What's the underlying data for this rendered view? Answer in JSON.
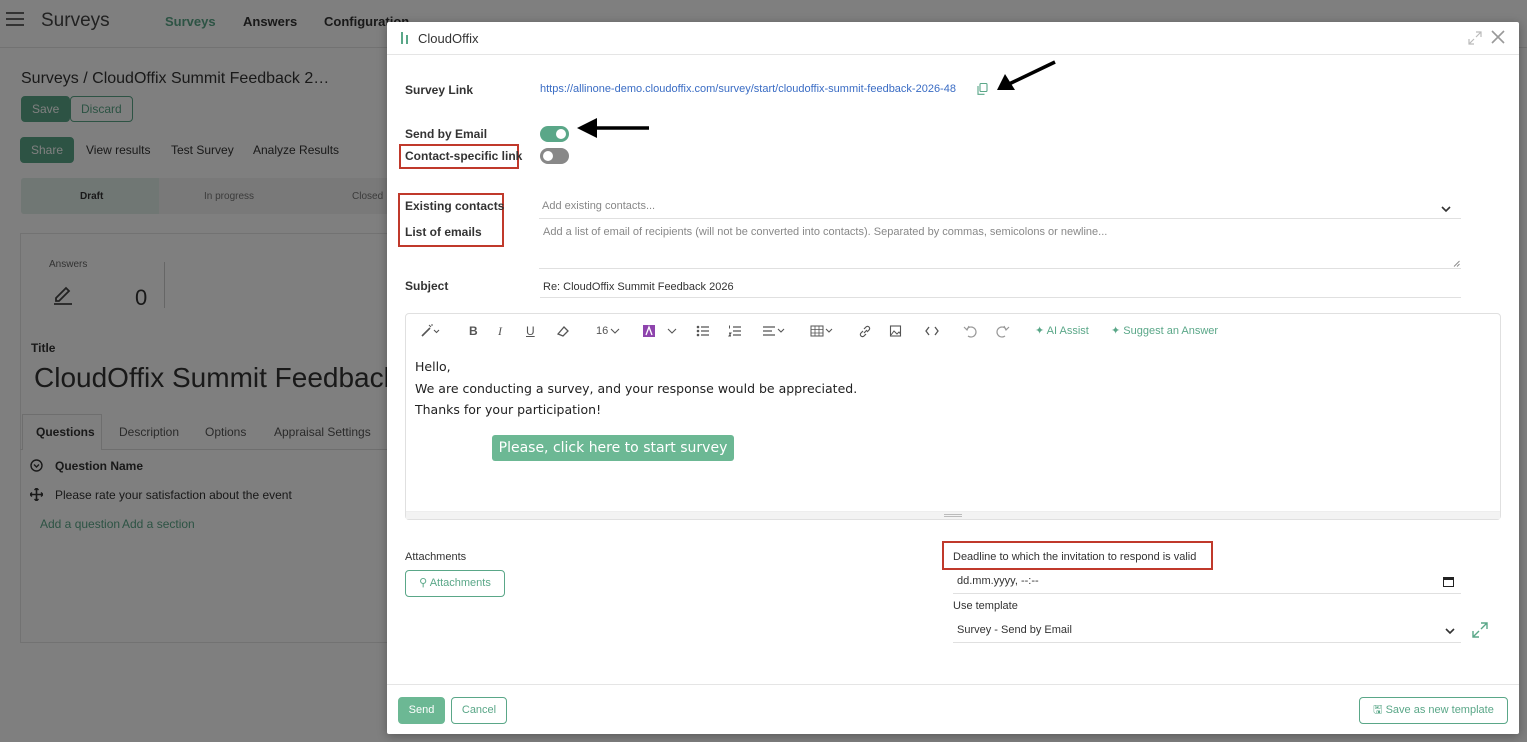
{
  "app": {
    "title": "Surveys",
    "nav": [
      "Surveys",
      "Answers",
      "Configuration"
    ],
    "breadcrumb": "Surveys /  CloudOffix Summit Feedback 2…",
    "save_label": "Save",
    "discard_label": "Discard",
    "share_label": "Share",
    "links": [
      "View results",
      "Test Survey",
      "Analyze Results"
    ],
    "status_steps": [
      "Draft",
      "In progress",
      "Closed"
    ],
    "answers_label": "Answers",
    "answers_count": "0",
    "title_label": "Title",
    "title_value": "CloudOffix Summit Feedback",
    "tabs": [
      "Questions",
      "Description",
      "Options",
      "Appraisal Settings"
    ],
    "question_header": "Question Name",
    "question_row": "Please rate your satisfaction about the event",
    "add_question": "Add a question",
    "add_section": "Add a section"
  },
  "modal": {
    "title": "CloudOffix",
    "survey_link_label": "Survey Link",
    "survey_link": "https://allinone-demo.cloudoffix.com/survey/start/cloudoffix-summit-feedback-2026-48",
    "send_by_email_label": "Send by Email",
    "send_by_email": true,
    "contact_specific_label": "Contact-specific link",
    "contact_specific": false,
    "existing_contacts_label": "Existing contacts",
    "existing_contacts_placeholder": "Add existing contacts...",
    "list_emails_label": "List of emails",
    "list_emails_placeholder": "Add a list of email of recipients (will not be converted into contacts). Separated by commas, semicolons or newline...",
    "subject_label": "Subject",
    "subject_value": "Re: CloudOffix Summit Feedback 2026",
    "toolbar": {
      "font_size": "16",
      "ai_assist": "AI Assist",
      "suggest_answer": "Suggest an Answer"
    },
    "body": {
      "line1": "Hello,",
      "line2": "We are conducting a survey, and your response would be appreciated.",
      "line3": "Thanks for your participation!",
      "cta": "Please, click here to start survey"
    },
    "attachments_label": "Attachments",
    "attachments_button": "Attachments",
    "deadline_label": "Deadline to which the invitation to respond is valid",
    "deadline_placeholder": "dd.mm.yyyy, --:--",
    "template_label": "Use template",
    "template_value": "Survey - Send by Email",
    "send_label": "Send",
    "cancel_label": "Cancel",
    "save_template_label": "Save as new template"
  },
  "colors": {
    "accent": "#5aa788",
    "link": "#3a6cc4",
    "highlight_box": "#c0392b"
  }
}
